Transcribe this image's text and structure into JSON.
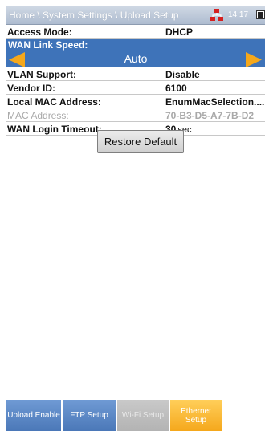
{
  "header": {
    "breadcrumb": "Home \\ System Settings \\ Upload Setup",
    "time": "14:17",
    "network_icon": "network-icon",
    "battery_icon": "battery-icon"
  },
  "rows": {
    "access_mode": {
      "label": "Access Mode:",
      "value": "DHCP"
    },
    "wan_link_speed": {
      "label": "WAN Link Speed:",
      "value": "Auto"
    },
    "vlan_support": {
      "label": "VLAN Support:",
      "value": "Disable"
    },
    "vendor_id": {
      "label": "Vendor ID:",
      "value": "6100"
    },
    "local_mac": {
      "label": "Local MAC Address:",
      "value": "EnumMacSelection...."
    },
    "mac_address": {
      "label": "MAC Address:",
      "value": "70-B3-D5-A7-7B-D2"
    },
    "wan_login_timeout": {
      "label": "WAN Login Timeout:",
      "value": "30",
      "unit": "sec"
    }
  },
  "buttons": {
    "restore_default": "Restore Default"
  },
  "tabs": [
    {
      "label": "Upload Enable",
      "state": "normal"
    },
    {
      "label": "FTP Setup",
      "state": "normal"
    },
    {
      "label": "Wi-Fi Setup",
      "state": "disabled"
    },
    {
      "label": "Ethernet Setup",
      "state": "active"
    }
  ],
  "colors": {
    "header": "#aebcd0",
    "selector": "#3e73b9",
    "arrow": "#f5a81c",
    "tab_blue": "#4b78b8",
    "tab_active": "#f5a81c",
    "tab_disabled": "#b3b3b3"
  }
}
